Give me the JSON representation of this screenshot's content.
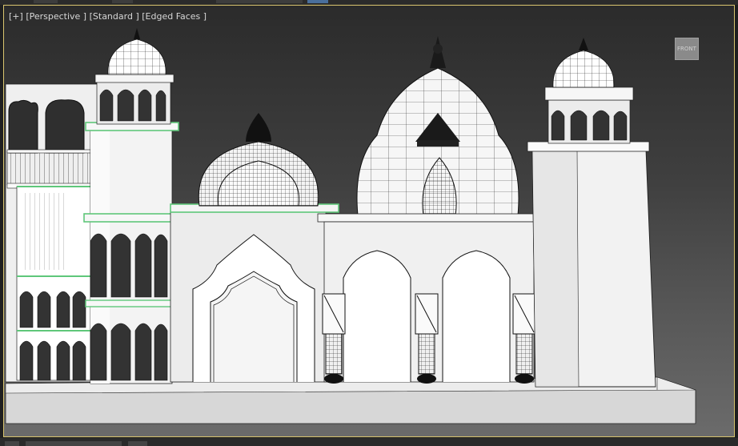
{
  "viewport": {
    "label_parts": [
      "[+]",
      "[Perspective ]",
      "[Standard ]",
      "[Edged Faces ]"
    ],
    "viewcube_label": "FRONT"
  },
  "colors": {
    "border_active": "#d9c56e",
    "label_text": "#d6d6d6",
    "model_fill": "#f2f2f2",
    "wire": "#111111",
    "selection_edge": "#5fc77a"
  },
  "icons": {
    "viewcube": "viewcube-icon"
  }
}
